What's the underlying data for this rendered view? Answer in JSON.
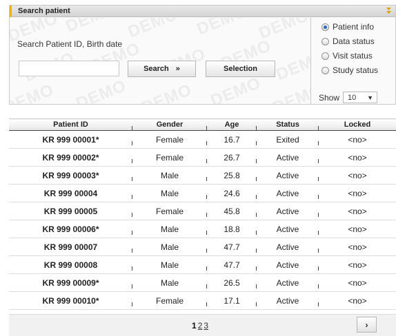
{
  "panel": {
    "title": "Search patient",
    "watermark": "DEMO"
  },
  "search": {
    "label": "Search Patient ID, Birth date",
    "value": "",
    "placeholder": "",
    "search_button": "Search",
    "search_button_arrows": "»",
    "selection_button": "Selection"
  },
  "options": {
    "radios": [
      {
        "label": "Patient info",
        "selected": true
      },
      {
        "label": "Data status",
        "selected": false
      },
      {
        "label": "Visit status",
        "selected": false
      },
      {
        "label": "Study status",
        "selected": false
      }
    ],
    "show_label": "Show",
    "show_value": "10"
  },
  "table": {
    "columns": [
      "Patient ID",
      "Gender",
      "Age",
      "Status",
      "Locked"
    ],
    "rows": [
      {
        "patient_id": "KR 999 00001*",
        "gender": "Female",
        "age": "16.7",
        "status": "Exited",
        "locked": "<no>"
      },
      {
        "patient_id": "KR 999 00002*",
        "gender": "Female",
        "age": "26.7",
        "status": "Active",
        "locked": "<no>"
      },
      {
        "patient_id": "KR 999 00003*",
        "gender": "Male",
        "age": "25.8",
        "status": "Active",
        "locked": "<no>"
      },
      {
        "patient_id": "KR 999 00004",
        "gender": "Male",
        "age": "24.6",
        "status": "Active",
        "locked": "<no>"
      },
      {
        "patient_id": "KR 999 00005",
        "gender": "Female",
        "age": "45.8",
        "status": "Active",
        "locked": "<no>"
      },
      {
        "patient_id": "KR 999 00006*",
        "gender": "Male",
        "age": "18.8",
        "status": "Active",
        "locked": "<no>"
      },
      {
        "patient_id": "KR 999 00007",
        "gender": "Male",
        "age": "47.7",
        "status": "Active",
        "locked": "<no>"
      },
      {
        "patient_id": "KR 999 00008",
        "gender": "Male",
        "age": "47.7",
        "status": "Active",
        "locked": "<no>"
      },
      {
        "patient_id": "KR 999 00009*",
        "gender": "Male",
        "age": "26.5",
        "status": "Active",
        "locked": "<no>"
      },
      {
        "patient_id": "KR 999 00010*",
        "gender": "Female",
        "age": "17.1",
        "status": "Active",
        "locked": "<no>"
      }
    ]
  },
  "pager": {
    "current": "1",
    "pages": [
      "2",
      "3"
    ],
    "next_label": "›"
  },
  "colors": {
    "accent": "#f0b400",
    "radio_selected": "#2b66c8"
  }
}
